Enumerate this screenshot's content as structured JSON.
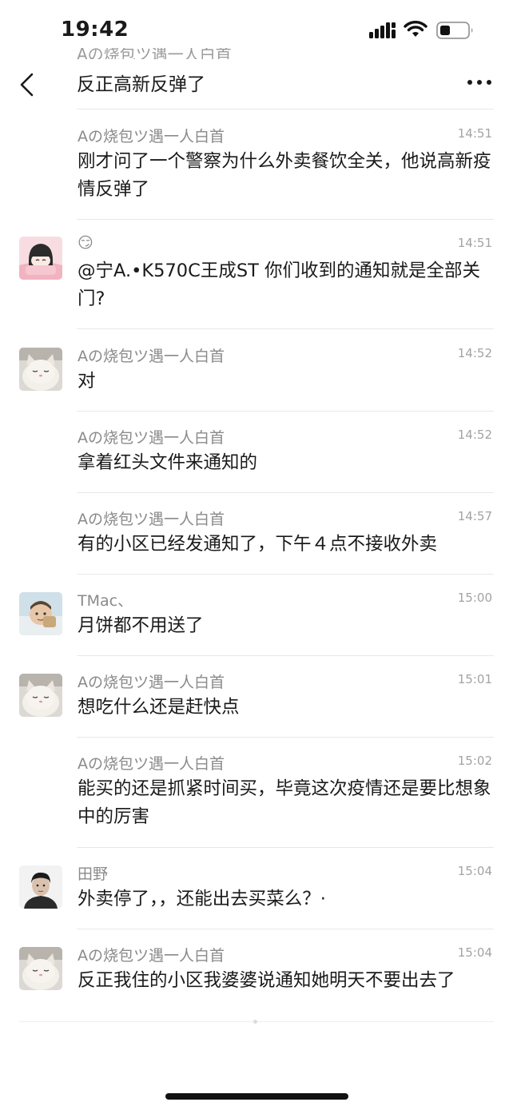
{
  "status_bar": {
    "time": "19:42"
  },
  "header": {
    "clipped_text": "Aの烧包ツ遇一人白首",
    "title": "反正高新反弹了"
  },
  "messages": [
    {
      "sender": "Aの烧包ツ遇一人白首",
      "time": "14:51",
      "text": "刚才问了一个警察为什么外卖餐饮全关，他说高新疫情反弹了",
      "avatar": "none"
    },
    {
      "sender": "😏",
      "time": "14:51",
      "text": "@宁A.•K570C王成ST 你们收到的通知就是全部关门?",
      "avatar": "cartoon-girl-avatar"
    },
    {
      "sender": "Aの烧包ツ遇一人白首",
      "time": "14:52",
      "text": "对",
      "avatar": "cat-avatar"
    },
    {
      "sender": "Aの烧包ツ遇一人白首",
      "time": "14:52",
      "text": "拿着红头文件来通知的",
      "avatar": "none"
    },
    {
      "sender": "Aの烧包ツ遇一人白首",
      "time": "14:57",
      "text": "有的小区已经发通知了，下午４点不接收外卖",
      "avatar": "none"
    },
    {
      "sender": "TMac、",
      "time": "15:00",
      "text": "月饼都不用送了",
      "avatar": "baby-avatar"
    },
    {
      "sender": "Aの烧包ツ遇一人白首",
      "time": "15:01",
      "text": "想吃什么还是赶快点",
      "avatar": "cat-avatar"
    },
    {
      "sender": "Aの烧包ツ遇一人白首",
      "time": "15:02",
      "text": "能买的还是抓紧时间买，毕竟这次疫情还是要比想象中的厉害",
      "avatar": "none"
    },
    {
      "sender": "田野",
      "time": "15:04",
      "text": "外卖停了，，还能出去买菜么？·",
      "avatar": "man-portrait-avatar"
    },
    {
      "sender": "Aの烧包ツ遇一人白首",
      "time": "15:04",
      "text": "反正我住的小区我婆婆说通知她明天不要出去了",
      "avatar": "cat-avatar"
    }
  ]
}
